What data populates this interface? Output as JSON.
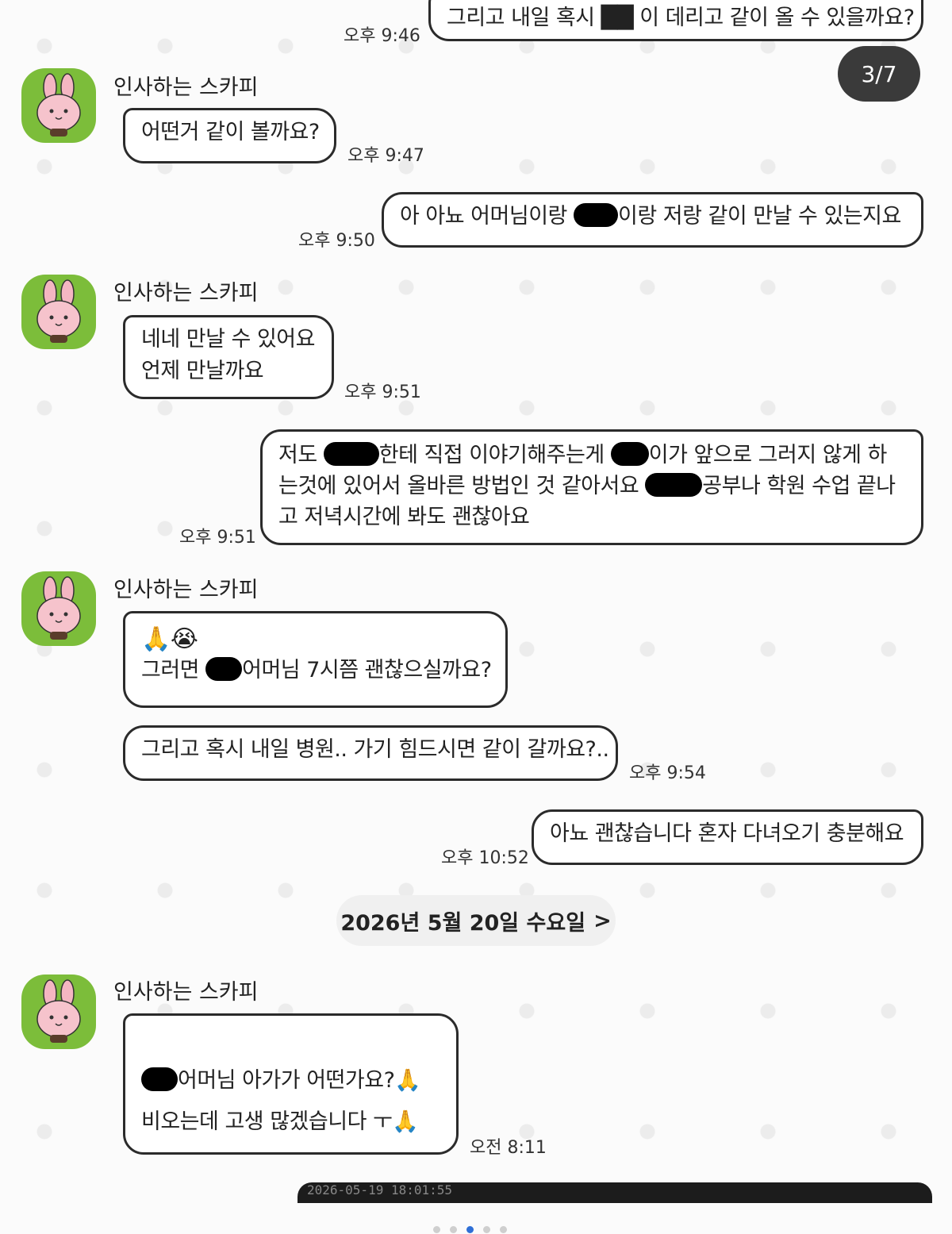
{
  "colors": {
    "avatar_bg": "#7cbd3a",
    "active_dot": "#2f6fd6",
    "counter_bg": "#3a3a3a"
  },
  "page_counter": "3/7",
  "sender_name": "인사하는 스카피",
  "messages": [
    {
      "text": "그리고 내일 혹시 ██ 이 데리고 같이 올 수 있을까요?",
      "time": "오후 9:46"
    },
    {
      "text": "어떤거 같이 볼까요?",
      "time": "오후 9:47"
    },
    {
      "text_a": "아 아뇨 어머님이랑",
      "text_b": "이랑 저랑 같이 만날 수 있는지요",
      "time": "오후 9:50"
    },
    {
      "line1": "네네 만날 수 있어요",
      "line2": "언제 만날까요",
      "time": "오후 9:51"
    },
    {
      "line1_a": "저도",
      "line1_b": "한테 직접 이야기해주는게",
      "line1_c": "이가 앞으로 그러지 않게 하",
      "line2_a": "는것에 있어서 올바른 방법인 것 같아서요",
      "line2_b": "공부나 학원 수업 끝나",
      "line3": "고 저녁시간에 봐도 괜찮아요",
      "time": "오후 9:51"
    },
    {
      "emoji": "🙏😭",
      "line2_a": "그러면",
      "line2_b": "어머님 7시쯤 괜찮으실까요?"
    },
    {
      "text": "그리고 혹시 내일 병원.. 가기 힘드시면 같이 갈까요?..",
      "time": "오후 9:54"
    },
    {
      "text": "아뇨 괜찮습니다 혼자 다녀오기 충분해요",
      "time": "오후 10:52"
    },
    {
      "line1": "어머님 아가가 어떤가요?🙏",
      "line2": "비오는데 고생 많겠습니다 ㅜ🙏",
      "time": "오전 8:11"
    }
  ],
  "date_divider": "2026년 5월 20일 수요일",
  "date_chevron": ">",
  "photo_caption": "2026-05-19 18:01:55"
}
